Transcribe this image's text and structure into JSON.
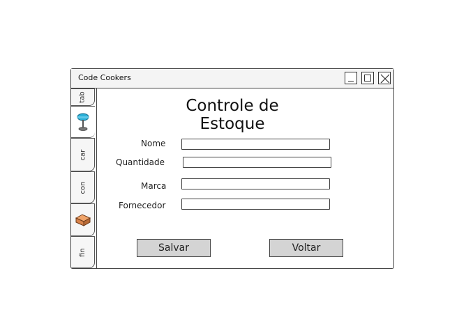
{
  "window": {
    "title": "Code Cookers"
  },
  "tabs": [
    {
      "label": "tab",
      "type": "text"
    },
    {
      "label": "",
      "type": "icon",
      "icon": "lamp-icon"
    },
    {
      "label": "car",
      "type": "text"
    },
    {
      "label": "con",
      "type": "text"
    },
    {
      "label": "",
      "type": "icon",
      "icon": "brick-icon"
    },
    {
      "label": "fin",
      "type": "text"
    }
  ],
  "form": {
    "heading": "Controle de Estoque",
    "fields": [
      {
        "label": "Nome",
        "value": ""
      },
      {
        "label": "Quantidade",
        "value": ""
      },
      {
        "label": "Marca",
        "value": ""
      },
      {
        "label": "Fornecedor",
        "value": ""
      }
    ],
    "save_label": "Salvar",
    "back_label": "Voltar"
  },
  "colors": {
    "border": "#444444",
    "button": "#d4d4d4",
    "lamp": "#2ab0d8",
    "brick": "#d9834a"
  }
}
